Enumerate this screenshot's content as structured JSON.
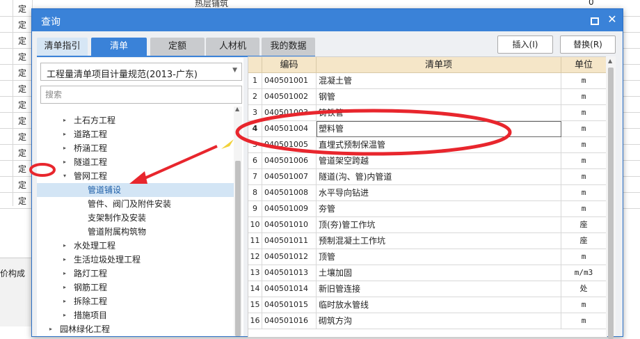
{
  "background_sheet": {
    "row_marks": [
      "定",
      "定",
      "定",
      "定",
      "定",
      "定",
      "定",
      "定",
      "定",
      "定",
      "定",
      "定",
      "定"
    ],
    "partial_title": "热层铺筑",
    "zero_value": "0",
    "bottom_pane_label": "价构成"
  },
  "dialog": {
    "title": "查询",
    "tabs": [
      {
        "label": "清单指引"
      },
      {
        "label": "清单"
      },
      {
        "label": "定额"
      },
      {
        "label": "人材机"
      },
      {
        "label": "我的数据"
      }
    ],
    "insert_button": "插入(I)",
    "replace_button": "替换(R)",
    "standard_select": "工程量清单项目计量规范(2013-广东)",
    "search_placeholder": "搜索",
    "tree": [
      {
        "label": "土石方工程",
        "expander": "▸"
      },
      {
        "label": "道路工程",
        "expander": "▸"
      },
      {
        "label": "桥涵工程",
        "expander": "▸"
      },
      {
        "label": "隧道工程",
        "expander": "▸"
      },
      {
        "label": "管网工程",
        "expander": "▾"
      },
      {
        "label": "管道铺设",
        "expander": ""
      },
      {
        "label": "管件、阀门及附件安装",
        "expander": ""
      },
      {
        "label": "支架制作及安装",
        "expander": ""
      },
      {
        "label": "管道附属构筑物",
        "expander": ""
      },
      {
        "label": "水处理工程",
        "expander": "▸"
      },
      {
        "label": "生活垃圾处理工程",
        "expander": "▸"
      },
      {
        "label": "路灯工程",
        "expander": "▸"
      },
      {
        "label": "钢筋工程",
        "expander": "▸"
      },
      {
        "label": "拆除工程",
        "expander": "▸"
      },
      {
        "label": "措施项目",
        "expander": "▸"
      },
      {
        "label": "园林绿化工程",
        "expander": "▸"
      }
    ],
    "table": {
      "headers": {
        "code": "编码",
        "item": "清单项",
        "unit": "单位"
      },
      "rows": [
        {
          "num": "1",
          "code": "040501001",
          "name": "混凝土管",
          "unit": "m"
        },
        {
          "num": "2",
          "code": "040501002",
          "name": "钢管",
          "unit": "m"
        },
        {
          "num": "3",
          "code": "040501003",
          "name": "铸铁管",
          "unit": "m"
        },
        {
          "num": "4",
          "code": "040501004",
          "name": "塑料管",
          "unit": "m"
        },
        {
          "num": "5",
          "code": "040501005",
          "name": "直埋式预制保温管",
          "unit": "m"
        },
        {
          "num": "6",
          "code": "040501006",
          "name": "管道架空跨越",
          "unit": "m"
        },
        {
          "num": "7",
          "code": "040501007",
          "name": "隧道(沟、管)内管道",
          "unit": "m"
        },
        {
          "num": "8",
          "code": "040501008",
          "name": "水平导向钻进",
          "unit": "m"
        },
        {
          "num": "9",
          "code": "040501009",
          "name": "夯管",
          "unit": "m"
        },
        {
          "num": "10",
          "code": "040501010",
          "name": "顶(夯)管工作坑",
          "unit": "座"
        },
        {
          "num": "11",
          "code": "040501011",
          "name": "预制混凝土工作坑",
          "unit": "座"
        },
        {
          "num": "12",
          "code": "040501012",
          "name": "顶管",
          "unit": "m"
        },
        {
          "num": "13",
          "code": "040501013",
          "name": "土壤加固",
          "unit": "m/m3"
        },
        {
          "num": "14",
          "code": "040501014",
          "name": "新旧管连接",
          "unit": "处"
        },
        {
          "num": "15",
          "code": "040501015",
          "name": "临时放水管线",
          "unit": "m"
        },
        {
          "num": "16",
          "code": "040501016",
          "name": "砌筑方沟",
          "unit": "m"
        }
      ]
    }
  },
  "colors": {
    "title_bar": "#3a82d8",
    "header_bg": "#f5e6c8",
    "selected_tree_bg": "#d3e5f5",
    "annotation": "#e8262d"
  }
}
